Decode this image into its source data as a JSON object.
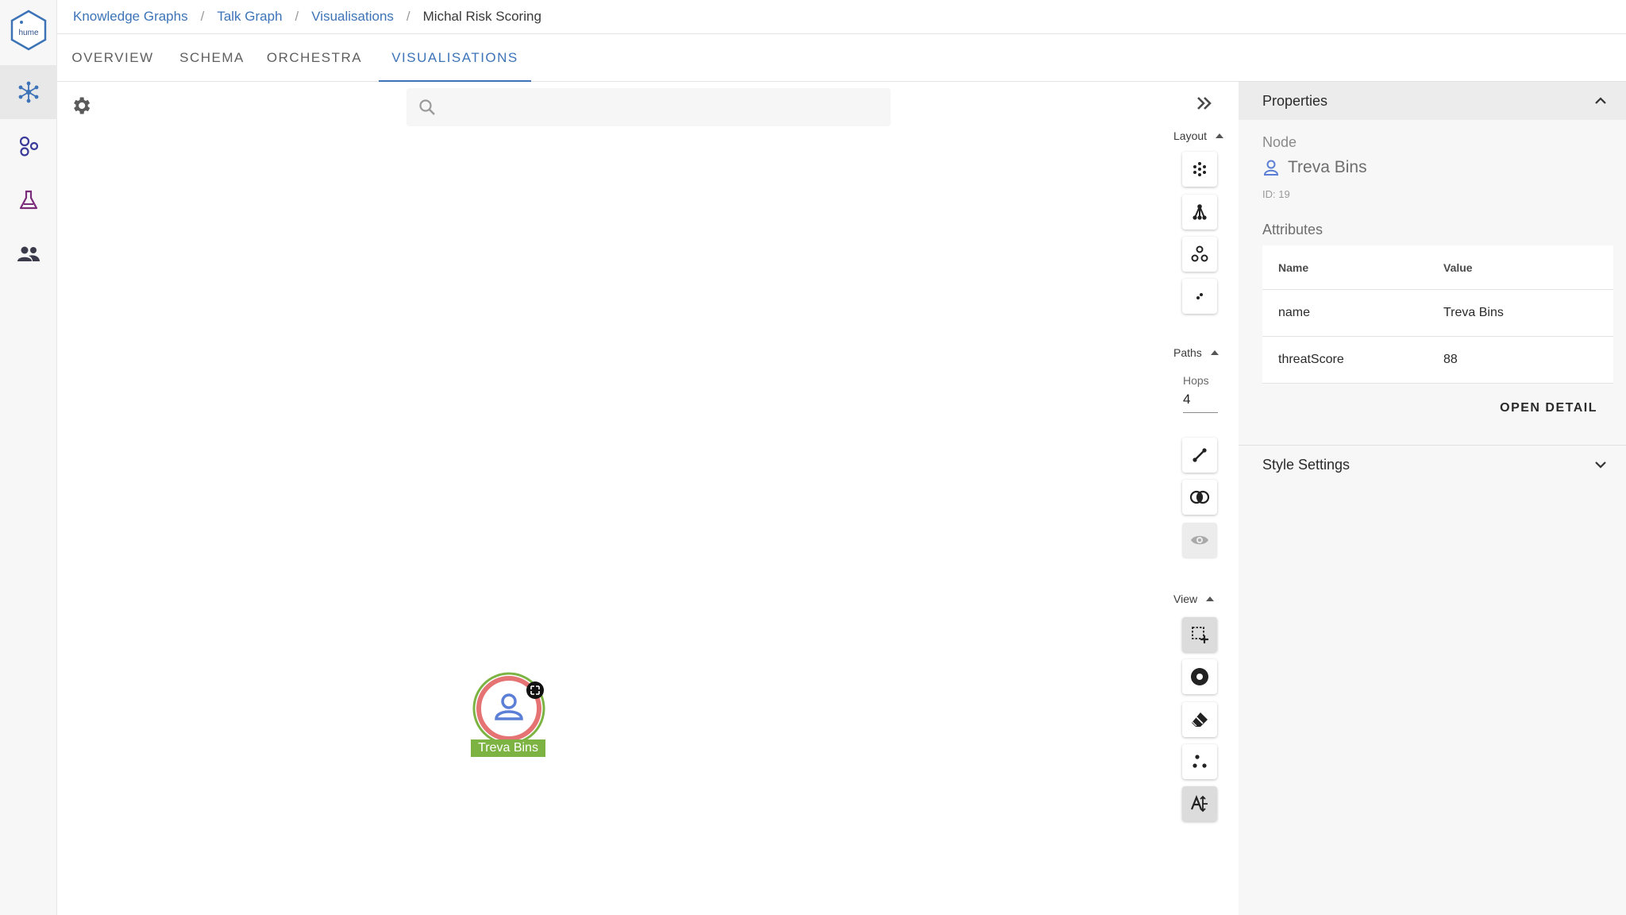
{
  "app": {
    "logo_text": "hume"
  },
  "breadcrumb": {
    "items": [
      "Knowledge Graphs",
      "Talk Graph",
      "Visualisations"
    ],
    "current": "Michal Risk Scoring",
    "separator": "/"
  },
  "tabs": [
    {
      "label": "OVERVIEW"
    },
    {
      "label": "SCHEMA"
    },
    {
      "label": "ORCHESTRA"
    },
    {
      "label": "VISUALISATIONS",
      "active": true
    }
  ],
  "search": {
    "placeholder": "",
    "value": ""
  },
  "graph": {
    "node": {
      "label": "Treva Bins",
      "icon": "person-icon"
    }
  },
  "toolbar": {
    "layout_label": "Layout",
    "paths_label": "Paths",
    "hops_label": "Hops",
    "hops_value": "4",
    "view_label": "View"
  },
  "properties": {
    "title": "Properties",
    "type_label": "Node",
    "node_name": "Treva Bins",
    "node_id": "ID: 19",
    "attributes_title": "Attributes",
    "columns": {
      "name": "Name",
      "value": "Value"
    },
    "rows": [
      {
        "name": "name",
        "value": "Treva Bins"
      },
      {
        "name": "threatScore",
        "value": "88"
      }
    ],
    "open_detail": "OPEN DETAIL",
    "style_settings": "Style Settings"
  },
  "colors": {
    "accent": "#3d74b8",
    "node_ring_outer": "#7cb342",
    "node_ring_inner": "#e57373",
    "node_icon": "#5b7fd6",
    "label_bg": "#7cb342"
  }
}
